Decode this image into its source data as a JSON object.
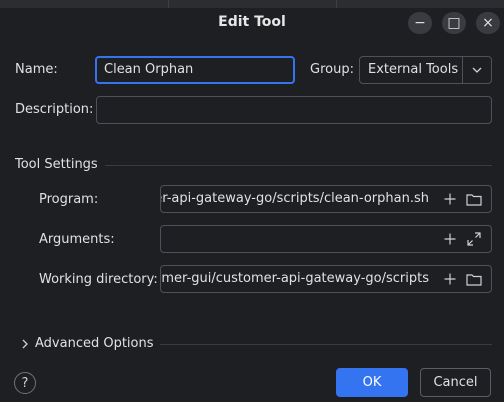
{
  "window": {
    "title": "Edit Tool",
    "controls": {
      "minimize": "−",
      "maximize": "□",
      "close": "×"
    }
  },
  "form": {
    "name_label": "Name:",
    "name_value": "Clean Orphan",
    "group_label": "Group:",
    "group_value": "External Tools",
    "description_label": "Description:",
    "description_value": ""
  },
  "tool_settings": {
    "title": "Tool Settings",
    "program_label": "Program:",
    "program_value": "er-api-gateway-go/scripts/clean-orphan.sh",
    "arguments_label": "Arguments:",
    "arguments_value": "",
    "working_dir_label": "Working directory:",
    "working_dir_value": "mer-gui/customer-api-gateway-go/scripts"
  },
  "advanced": {
    "label": "Advanced Options"
  },
  "buttons": {
    "help": "?",
    "ok": "OK",
    "cancel": "Cancel"
  },
  "colors": {
    "accent": "#3574f0",
    "background": "#1e1f22",
    "border": "#4e5157"
  },
  "icons": [
    "plus-icon",
    "folder-icon",
    "expand-icon",
    "chevron-down-icon",
    "chevron-right-icon",
    "help-icon"
  ]
}
